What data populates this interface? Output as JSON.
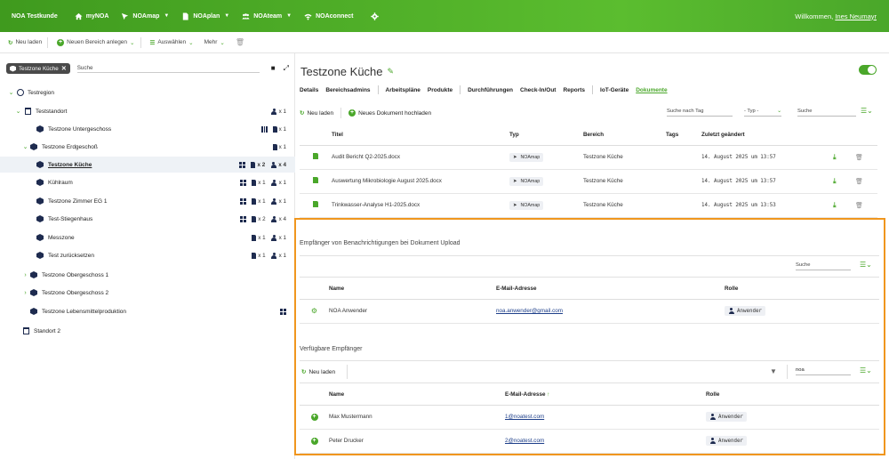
{
  "topnav": {
    "brand": "NOA Testkunde",
    "items": [
      {
        "label": "myNOA",
        "caret": false
      },
      {
        "label": "NOAmap",
        "caret": true
      },
      {
        "label": "NOAplan",
        "caret": true
      },
      {
        "label": "NOAteam",
        "caret": true
      },
      {
        "label": "NOAconnect",
        "caret": true
      }
    ],
    "welcome": "Willkommen,",
    "user": "Ines Neumayr"
  },
  "toolbar": {
    "reload": "Neu laden",
    "new_area": "Neuen Bereich anlegen",
    "select": "Auswählen",
    "more": "Mehr"
  },
  "tree": {
    "chip": "Testzone Küche",
    "search_placeholder": "Suche",
    "rows": [
      {
        "label": "Testregion"
      },
      {
        "label": "Teststandort",
        "b1": "x 1"
      },
      {
        "label": "Testzone Untergeschoss",
        "b1": "x 1"
      },
      {
        "label": "Testzone Erdgeschoß",
        "b1": "x 1"
      },
      {
        "label": "Testzone Küche",
        "b1": "x 2",
        "b2": "x 4"
      },
      {
        "label": "Kühlraum",
        "b1": "x 1",
        "b2": "x 1"
      },
      {
        "label": "Testzone Zimmer EG 1",
        "b1": "x 1",
        "b2": "x 1"
      },
      {
        "label": "Test-Stiegenhaus",
        "b1": "x 2",
        "b2": "x 4"
      },
      {
        "label": "Messzone",
        "b1": "x 1",
        "b2": "x 1"
      },
      {
        "label": "Test zurücksetzen",
        "b1": "x 1",
        "b2": "x 1"
      },
      {
        "label": "Testzone Obergeschoss 1"
      },
      {
        "label": "Testzone Obergeschoss 2"
      },
      {
        "label": "Testzone Lebensmittelproduktion"
      },
      {
        "label": "Standort 2"
      }
    ]
  },
  "main": {
    "title": "Testzone Küche",
    "tabs": [
      "Details",
      "Bereichsadmins",
      "Arbeitspläne",
      "Produkte",
      "Durchführungen",
      "Check-In/Out",
      "Reports",
      "IoT-Geräte",
      "Dokumente"
    ],
    "reload": "Neu laden",
    "upload": "Neues Dokument hochladen",
    "filter_tag": "Suche nach Tag",
    "filter_type": "- Typ -",
    "filter_search": "Suche",
    "doc_headers": {
      "title": "Titel",
      "type": "Typ",
      "area": "Bereich",
      "tags": "Tags",
      "changed": "Zuletzt geändert"
    },
    "docs": [
      {
        "title": "Audit Bericht Q2-2025.docx",
        "type": "NOAmap",
        "area": "Testzone Küche",
        "changed": "14. August 2025 um 13:57"
      },
      {
        "title": "Auswertung Mikrobiologie August 2025.docx",
        "type": "NOAmap",
        "area": "Testzone Küche",
        "changed": "14. August 2025 um 13:57"
      },
      {
        "title": "Trinkwasser-Analyse H1-2025.docx",
        "type": "NOAmap",
        "area": "Testzone Küche",
        "changed": "14. August 2025 um 13:53"
      }
    ]
  },
  "recipients": {
    "title": "Empfänger von Benachrichtigungen bei Dokument Upload",
    "search": "Suche",
    "headers": {
      "name": "Name",
      "email": "E-Mail-Adresse",
      "role": "Rolle"
    },
    "rows": [
      {
        "name": "NOA Anwender",
        "email": "noa.anwender@gmail.com",
        "role": "Anwender"
      }
    ]
  },
  "available": {
    "title": "Verfügbare Empfänger",
    "reload": "Neu laden",
    "search_value": "noa",
    "headers": {
      "name": "Name",
      "email": "E-Mail-Adresse",
      "role": "Rolle"
    },
    "rows": [
      {
        "name": "Max Mustermann",
        "email": "1@noatest.com",
        "role": "Anwender"
      },
      {
        "name": "Peter Drucker",
        "email": "2@noatest.com",
        "role": "Anwender"
      }
    ]
  },
  "colors": {
    "accent": "#4aa72a",
    "highlight": "#f0961e",
    "navy": "#1e2b4f"
  }
}
